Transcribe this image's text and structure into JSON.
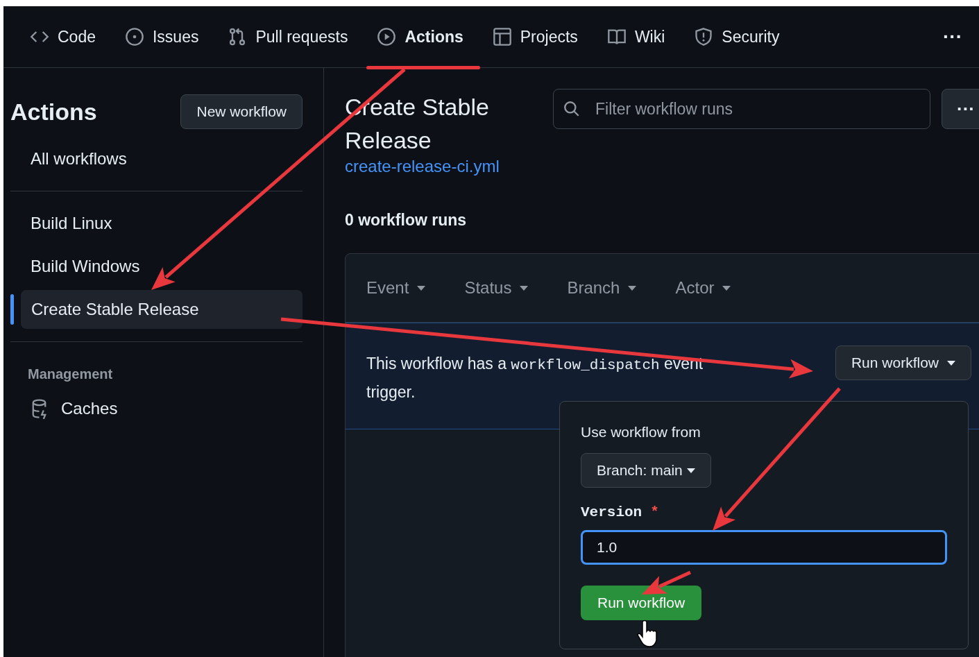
{
  "nav": {
    "tabs": [
      {
        "label": "Code",
        "selected": false
      },
      {
        "label": "Issues",
        "selected": false
      },
      {
        "label": "Pull requests",
        "selected": false
      },
      {
        "label": "Actions",
        "selected": true
      },
      {
        "label": "Projects",
        "selected": false
      },
      {
        "label": "Wiki",
        "selected": false
      },
      {
        "label": "Security",
        "selected": false
      }
    ],
    "more": "···"
  },
  "sidebar": {
    "title": "Actions",
    "new_button": "New workflow",
    "all": {
      "label": "All workflows",
      "selected": false
    },
    "items": [
      {
        "label": "Build Linux",
        "selected": false
      },
      {
        "label": "Build Windows",
        "selected": false
      },
      {
        "label": "Create Stable Release",
        "selected": true
      }
    ],
    "section": "Management",
    "management_items": [
      {
        "label": "Caches"
      }
    ]
  },
  "main": {
    "title": "Create Stable Release",
    "file_link": "create-release-ci.yml",
    "filter_placeholder": "Filter workflow runs",
    "more": "···",
    "runs_count": "0 workflow runs",
    "filters": [
      "Event",
      "Status",
      "Branch",
      "Actor"
    ],
    "banner": {
      "text_before": "This workflow has a",
      "code": "workflow_dispatch",
      "text_after": "event trigger.",
      "button": "Run workflow"
    },
    "popup": {
      "heading": "Use workflow from",
      "branch": "Branch: main",
      "field_label": "Version",
      "required": "*",
      "field_value": "1.0",
      "submit": "Run workflow"
    }
  }
}
